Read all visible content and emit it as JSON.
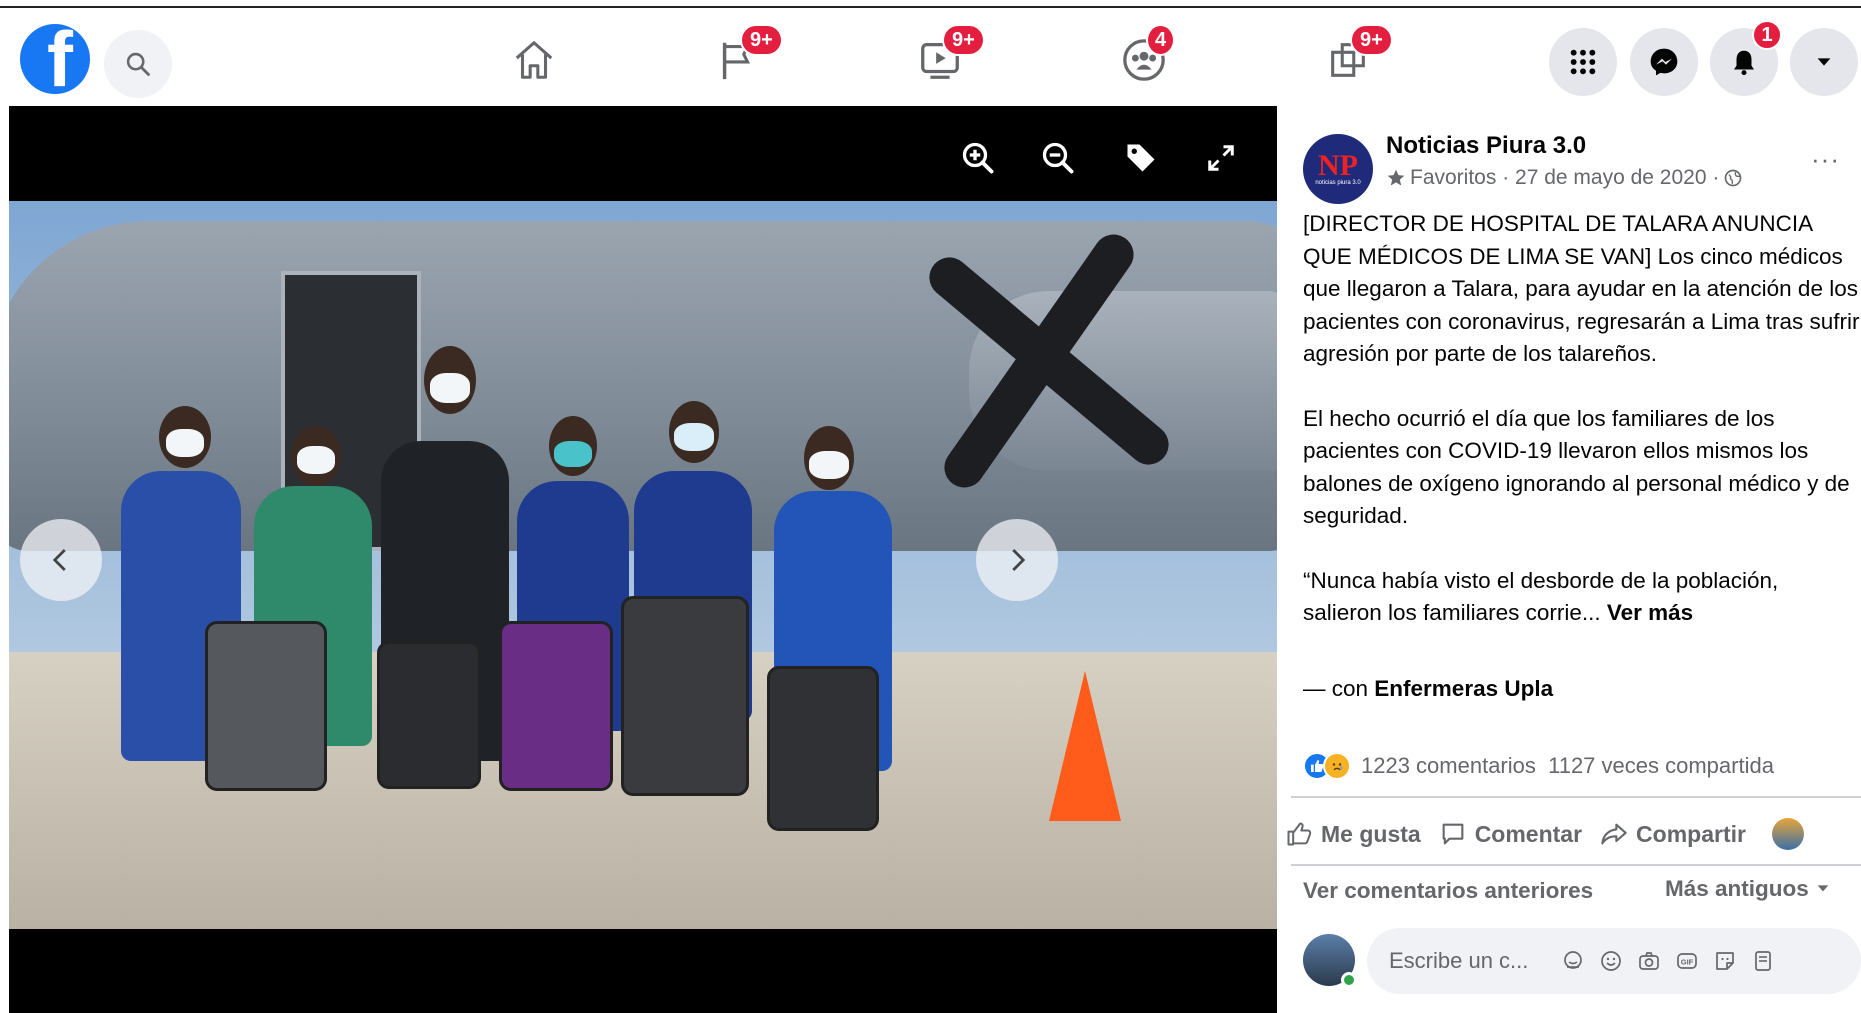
{
  "header": {
    "logo_letter": "f",
    "nav": [
      {
        "name": "home",
        "badge": ""
      },
      {
        "name": "pages",
        "badge": "9+"
      },
      {
        "name": "watch",
        "badge": "9+"
      },
      {
        "name": "groups",
        "badge": "4"
      },
      {
        "name": "gaming",
        "badge": "9+"
      }
    ],
    "notifications_badge": "1"
  },
  "viewer": {
    "tools": [
      "zoom-in",
      "zoom-out",
      "tag",
      "fullscreen"
    ]
  },
  "post": {
    "avatar_text": "NP",
    "avatar_subtext": "noticias piura 3.0",
    "page_name": "Noticias Piura 3.0",
    "meta": "Favoritos · 27 de mayo de 2020 ·",
    "more": "···",
    "paragraphs": [
      "[DIRECTOR DE HOSPITAL DE TALARA ANUNCIA QUE MÉDICOS DE LIMA SE VAN] Los cinco médicos que llegaron a Talara, para ayudar en la atención de los pacientes con coronavirus, regresarán a Lima tras sufrir agresión por parte de los talareños.",
      "El hecho ocurrió el día que los familiares de los pacientes con COVID-19 llevaron ellos mismos los balones de oxígeno ignorando al personal médico y de seguridad.",
      "“Nunca había visto el desborde de la población, salieron los familiares corrie..."
    ],
    "see_more": "Ver más",
    "with_prefix": "— con ",
    "with_name": "Enfermeras Upla",
    "stats": "1223 comentarios  1127 veces compartida",
    "actions": {
      "like": "Me gusta",
      "comment": "Comentar",
      "share": "Compartir"
    },
    "previous_comments": "Ver comentarios anteriores",
    "sort": "Más antiguos",
    "comment_placeholder": "Escribe un c..."
  }
}
